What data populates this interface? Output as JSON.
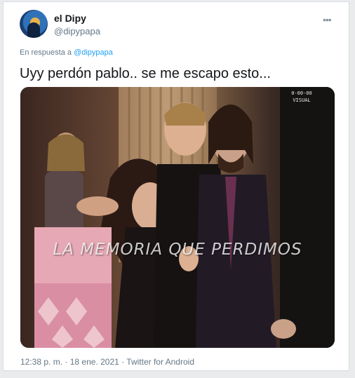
{
  "author": {
    "name": "el Dipy",
    "handle": "@dipypapa",
    "avatar_icon": "avatar-icon"
  },
  "more_menu": {
    "label": "•••",
    "icon": "more-icon"
  },
  "reply_context": {
    "prefix": "En respuesta a",
    "mention": "@dipypapa"
  },
  "tweet": {
    "text": "Uyy perdón pablo.. se me escapo esto..."
  },
  "media": {
    "overlay_caption": "LA MEMORIA QUE PERDIMOS",
    "corner_text_line1": "0-00-00",
    "corner_text_line2": "VISUAL"
  },
  "meta": {
    "time": "12:38 p. m.",
    "separator": "·",
    "date": "18 ene. 2021",
    "source": "Twitter for Android"
  },
  "colors": {
    "link": "#1da1f2",
    "text": "#14171a",
    "secondary": "#657786"
  }
}
